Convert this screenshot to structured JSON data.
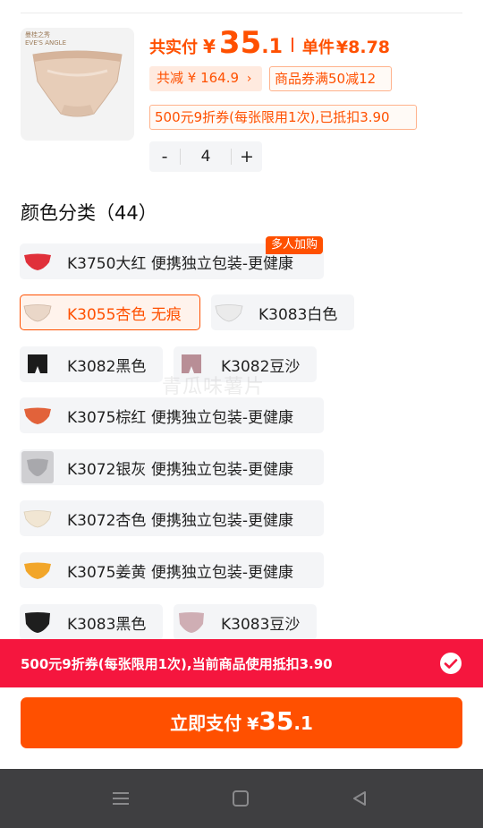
{
  "product": {
    "brand_text": "曼桂之秀 EVE'S ANGLE",
    "total_label": "共实付",
    "currency": "¥",
    "total_int": "35",
    "total_dec": ".1",
    "unit_label": "单件",
    "unit_price": "¥8.78",
    "discount_tag": "共减 ¥ 164.9",
    "coupon_tag": "商品券满50减12",
    "voucher_tag": "500元9折券(每张限用1次),已抵扣3.90",
    "quantity": {
      "minus": "-",
      "value": "4",
      "plus": "+"
    }
  },
  "colors_section": {
    "title": "颜色分类（44）",
    "options": [
      {
        "label": "K3750大红 便携独立包装-更健康",
        "swatch": "#e0303a",
        "badge": "多人加购",
        "selected": false
      },
      {
        "label": "K3055杏色 无痕",
        "swatch": "#ead7c8",
        "selected": true
      },
      {
        "label": "K3083白色",
        "swatch": "#e8e8e8",
        "selected": false
      },
      {
        "label": "K3082黑色",
        "swatch": "#1b1b1b",
        "selected": false
      },
      {
        "label": "K3082豆沙",
        "swatch": "#b88e96",
        "selected": false
      },
      {
        "label": "K3075棕红 便携独立包装-更健康",
        "swatch": "#e2623a",
        "selected": false
      },
      {
        "label": "K3072银灰 便携独立包装-更健康",
        "swatch": "#a8a8ac",
        "selected": false
      },
      {
        "label": "K3072杏色 便携独立包装-更健康",
        "swatch": "#f1e6d3",
        "selected": false
      },
      {
        "label": "K3075姜黄 便携独立包装-更健康",
        "swatch": "#f2a62a",
        "selected": false
      },
      {
        "label": "K3083黑色",
        "swatch": "#1e1e1e",
        "selected": false
      },
      {
        "label": "K3083豆沙",
        "swatch": "#cfaeb4",
        "selected": false
      }
    ]
  },
  "watermark": "青瓜味薯片",
  "voucher_bar": {
    "text": "500元9折券(每张限用1次),当前商品使用抵扣3.90",
    "icon": "check-circle-icon"
  },
  "pay_button": {
    "label": "立即支付",
    "currency": "¥",
    "int": "35",
    "dec": ".1"
  },
  "navbar": {
    "icons": [
      "menu-icon",
      "home-square-icon",
      "back-triangle-icon"
    ]
  },
  "theme": {
    "accent": "#ff5000",
    "voucher_red": "#f5163e",
    "navbar": "#3f3f41"
  }
}
